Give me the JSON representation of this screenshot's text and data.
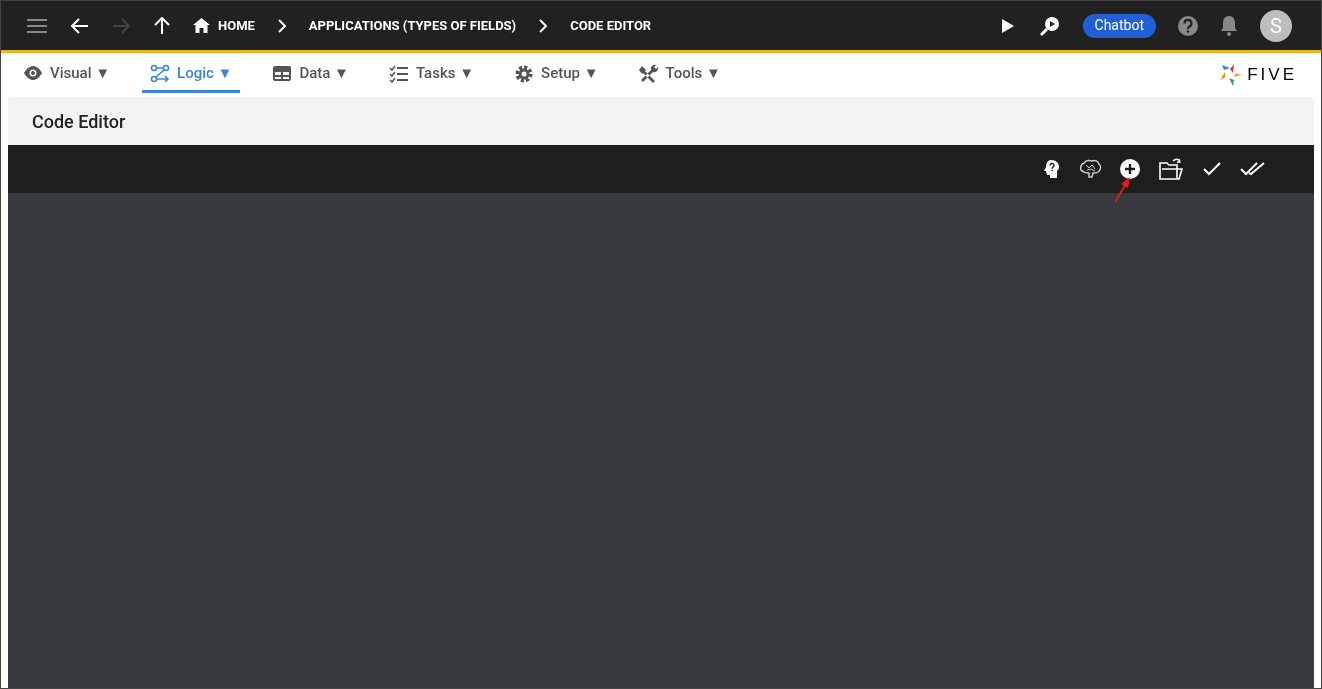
{
  "top_bar": {
    "breadcrumbs": [
      {
        "kind": "home",
        "label": "HOME"
      },
      {
        "kind": "plain",
        "label": "APPLICATIONS (TYPES OF FIELDS)"
      },
      {
        "kind": "plain",
        "label": "CODE EDITOR"
      }
    ],
    "chatbot_button": "Chatbot",
    "avatar": "S"
  },
  "menu": [
    {
      "kind": "eye",
      "label": "Visual",
      "caret": "▼",
      "selected": false
    },
    {
      "kind": "logic",
      "label": "Logic",
      "caret": "▼",
      "selected": true
    },
    {
      "kind": "table",
      "label": "Data",
      "caret": "▼",
      "selected": false
    },
    {
      "kind": "tasks",
      "label": "Tasks",
      "caret": "▼",
      "selected": false
    },
    {
      "kind": "gear",
      "label": "Setup",
      "caret": "▼",
      "selected": false
    },
    {
      "kind": "tools",
      "label": "Tools",
      "caret": "▼",
      "selected": false
    }
  ],
  "logo": "FIVE",
  "panel": {
    "title": "Code Editor"
  }
}
